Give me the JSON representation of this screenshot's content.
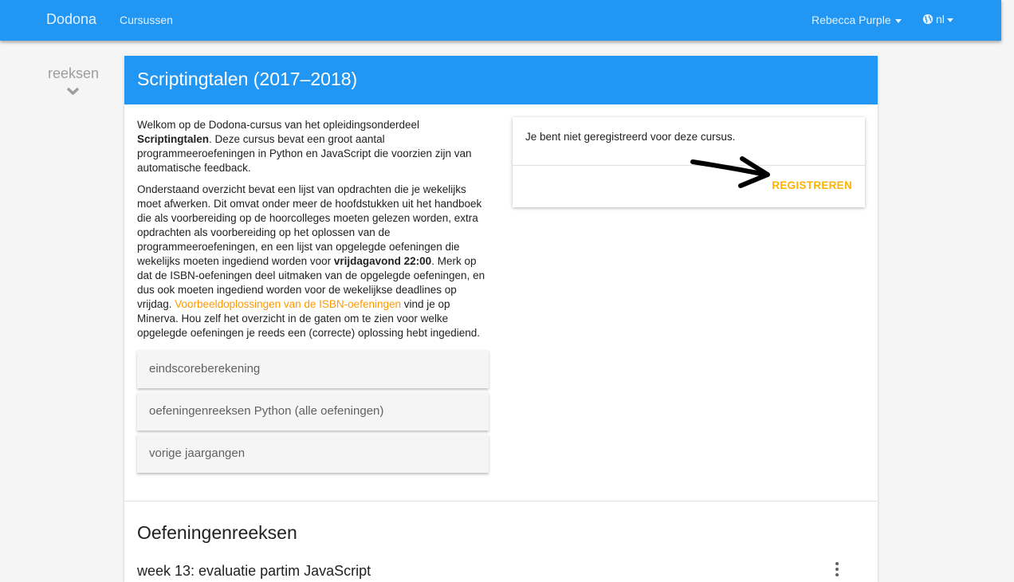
{
  "navbar": {
    "brand": "Dodona",
    "courses": "Cursussen",
    "user": "Rebecca Purple",
    "lang": "nl"
  },
  "sidebar": {
    "label": "reeksen",
    "icon": "chevron-down-icon"
  },
  "course": {
    "title": "Scriptingtalen (2017–2018)",
    "p1_a": "Welkom op de Dodona-cursus van het opleidingsonderdeel ",
    "p1_bold": "Scriptingtalen",
    "p1_b": ". Deze cursus bevat een groot aantal programmeeroefeningen in Python en JavaScript die voorzien zijn van automatische feedback.",
    "p2_a": "Onderstaand overzicht bevat een lijst van opdrachten die je wekelijks moet afwerken. Dit omvat onder meer de hoofdstukken uit het handboek die als voorbereiding op de hoorcolleges moeten gelezen worden, extra opdrachten als voorbereiding op het oplossen van de programmeeroefeningen, en een lijst van opgelegde oefeningen die wekelijks moeten ingediend worden voor ",
    "p2_bold": "vrijdagavond 22:00",
    "p2_b": ". Merk op dat de ISBN-oefeningen deel uitmaken van de opgelegde oefeningen, en dus ook moeten ingediend worden voor de wekelijkse deadlines op vrijdag. ",
    "p2_link": "Voorbeeldoplossingen van de ISBN-oefeningen",
    "p2_c": " vind je op Minerva. Hou zelf het overzicht in de gaten om te zien voor welke opgelegde oefeningen je reeds een (correcte) oplossing hebt ingediend.",
    "series_items": [
      "eindscoreberekening",
      "oefeningenreeksen Python (alle oefeningen)",
      "vorige jaargangen"
    ]
  },
  "registration": {
    "message": "Je bent niet geregistreerd voor deze cursus.",
    "button": "REGISTREREN",
    "annotation_icon": "arrow-right-icon"
  },
  "exercises": {
    "title": "Oefeningenreeksen",
    "first_week": "week 13: evaluatie partim JavaScript"
  },
  "colors": {
    "primary": "#2196f3",
    "accent": "#ffb300",
    "link": "#ff9800"
  }
}
